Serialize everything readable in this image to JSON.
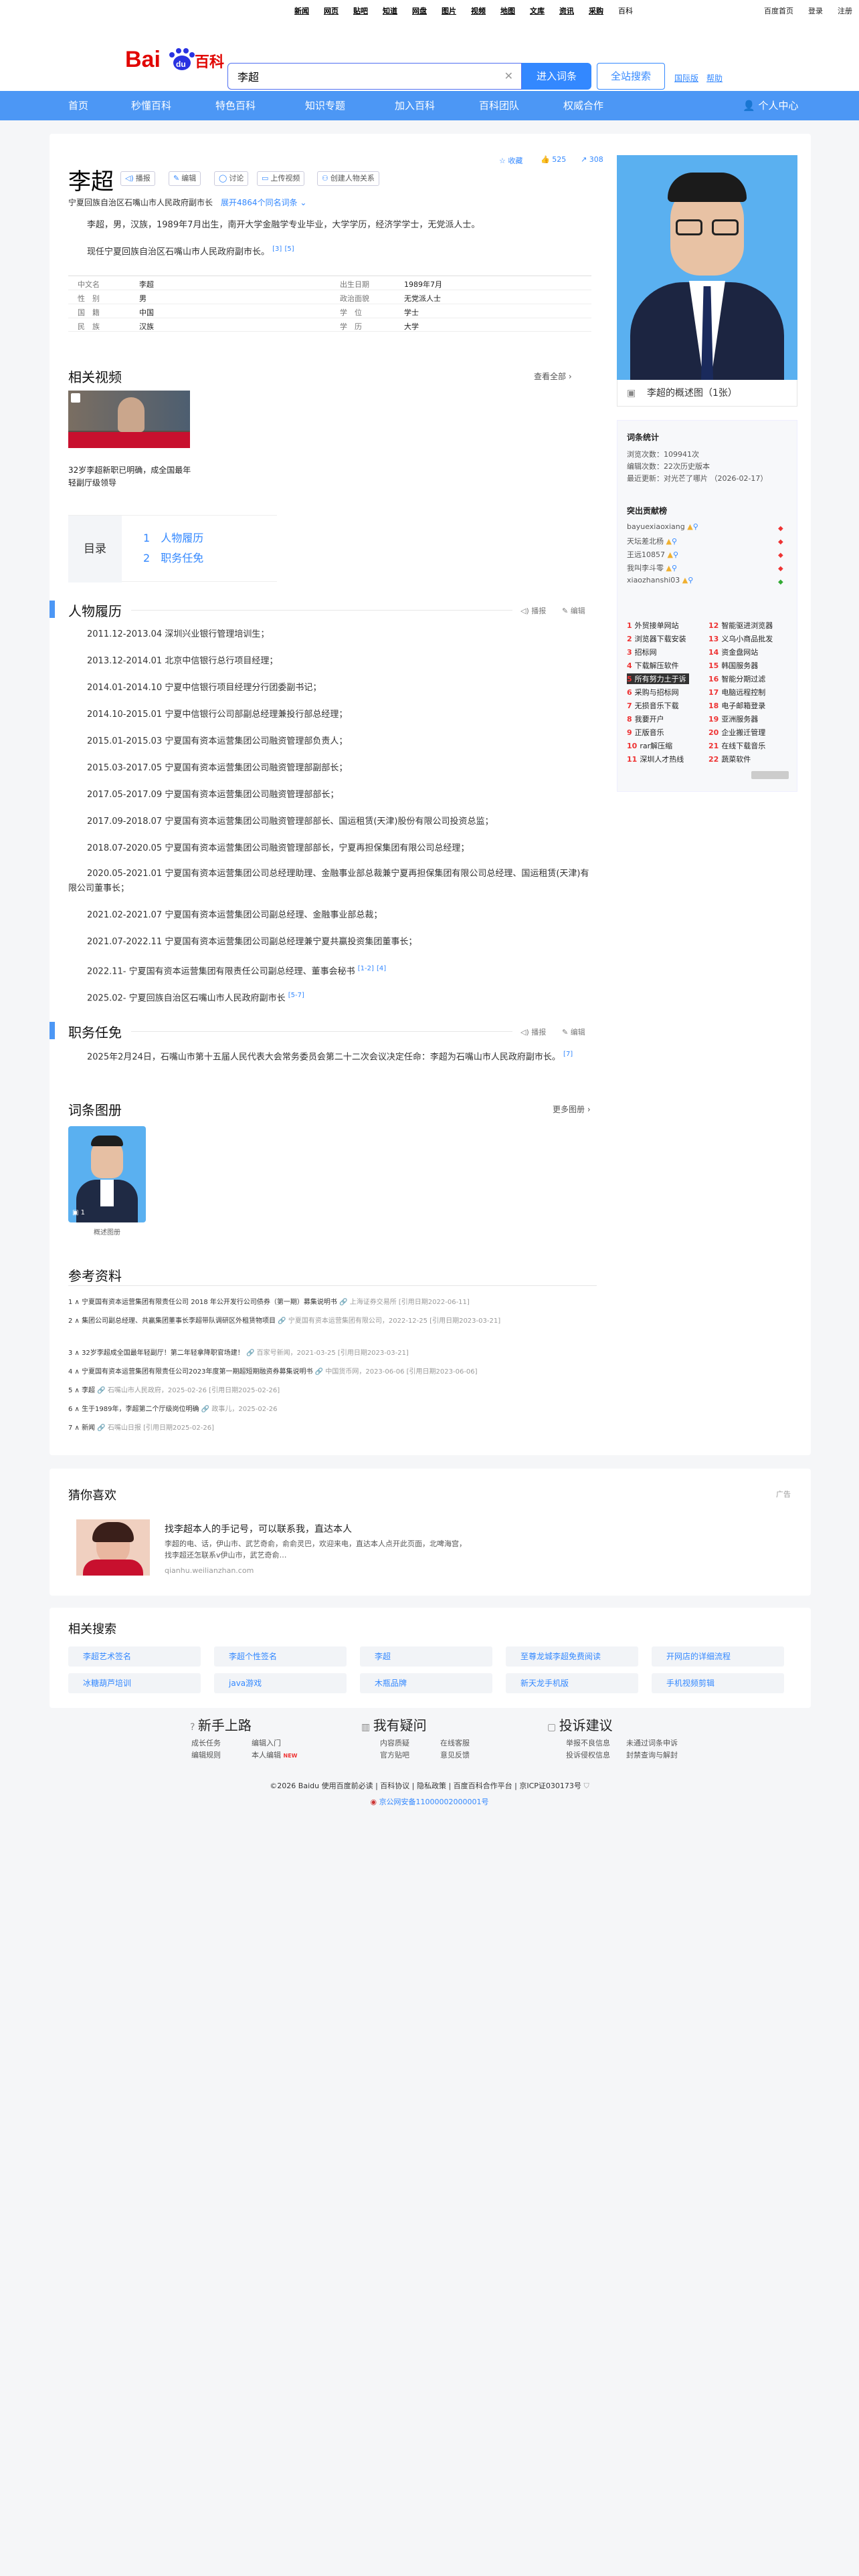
{
  "topnav": [
    "新闻",
    "网页",
    "贴吧",
    "知道",
    "网盘",
    "图片",
    "视频",
    "地图",
    "文库",
    "资讯",
    "采购",
    "百科"
  ],
  "topright": [
    "百度首页",
    "登录",
    "注册"
  ],
  "logo": {
    "text": "Baidu百科",
    "brand_color": "#2932e1",
    "red": "#e10602"
  },
  "search": {
    "value": "李超",
    "enter": "进入词条",
    "all": "全站搜索",
    "help1": "国际版",
    "help2": "帮助"
  },
  "nav": [
    "首页",
    "秒懂百科",
    "特色百科",
    "知识专题",
    "加入百科",
    "百科团队",
    "权威合作",
    "个人中心"
  ],
  "article": {
    "title": "李超",
    "buttons": [
      "播报",
      "编辑",
      "讨论",
      "上传视频",
      "创建人物关系"
    ],
    "stats": [
      "收藏",
      "525",
      "308"
    ],
    "subtitle": "宁夏回族自治区石嘴山市人民政府副市长",
    "more_link": "展开4864个同名词条",
    "summary1": "李超，男，汉族，1989年7月出生，南开大学金融学专业毕业，大学学历，经济学学士，无党派人士。",
    "summary2": "现任宁夏回族自治区石嘴山市人民政府副市长。",
    "sup1": "[3]",
    "sup2": "[5]",
    "info": [
      [
        "中文名",
        "李超",
        "出生日期",
        "1989年7月"
      ],
      [
        "性　别",
        "男",
        "政治面貌",
        "无党派人士"
      ],
      [
        "国　籍",
        "中国",
        "学　位",
        "学士"
      ],
      [
        "民　族",
        "汉族",
        "学　历",
        "大学"
      ]
    ]
  },
  "video": {
    "section": "相关视频",
    "more": "查看全部",
    "title": "32岁李超新职已明确，成全国最年轻副厅级领导"
  },
  "toc": {
    "label": "目录",
    "items": [
      "人物履历",
      "职务任免"
    ]
  },
  "career": {
    "section": "人物履历",
    "actions": [
      "播报",
      "编辑"
    ],
    "items": [
      "2011.12-2013.04 深圳兴业银行管理培训生；",
      "2013.12-2014.01 北京中信银行总行项目经理；",
      "2014.01-2014.10 宁夏中信银行项目经理分行团委副书记；",
      "2014.10-2015.01 宁夏中信银行公司部副总经理兼投行部总经理；",
      "2015.01-2015.03 宁夏国有资本运营集团公司融资管理部负责人；",
      "2015.03-2017.05 宁夏国有资本运营集团公司融资管理部副部长；",
      "2017.05-2017.09 宁夏国有资本运营集团公司融资管理部部长；",
      "2017.09-2018.07 宁夏国有资本运营集团公司融资管理部部长、国运租赁(天津)股份有限公司投资总监；",
      "2018.07-2020.05 宁夏国有资本运营集团公司融资管理部部长，宁夏再担保集团有限公司总经理；",
      "2020.05-2021.01 宁夏国有资本运营集团公司总经理助理、金融事业部总裁兼宁夏再担保集团有限公司总经理、国运租赁(天津)有限公司董事长；",
      "2021.02-2021.07 宁夏国有资本运营集团公司副总经理、金融事业部总裁；",
      "2021.07-2022.11 宁夏国有资本运营集团公司副总经理兼宁夏共赢投资集团董事长；",
      "2022.11- 宁夏国有资本运营集团有限责任公司副总经理、董事会秘书",
      "2025.02- 宁夏回族自治区石嘴山市人民政府副市长"
    ],
    "sup13": "[1-2]",
    "sup13b": "[4]",
    "sup14": "[5-7]"
  },
  "appoint": {
    "section": "职务任免",
    "actions": [
      "播报",
      "编辑"
    ],
    "text": "2025年2月24日，石嘴山市第十五届人民代表大会常务委员会第二十二次会议决定任命：李超为石嘴山市人民政府副市长。",
    "sup": "[7]"
  },
  "album": {
    "section": "词条图册",
    "more": "更多图册",
    "count": "1",
    "caption": "概述图册"
  },
  "refs": {
    "section": "参考资料",
    "items": [
      [
        "1",
        "宁夏国有资本运营集团有限责任公司 2018 年公开发行公司债券（第一期）募集说明书",
        "上海证券交易所 [引用日期2022-06-11]"
      ],
      [
        "2",
        "集团公司副总经理、共赢集团董事长李超带队调研区外租赁物项目",
        "宁夏国有资本运营集团有限公司，2022-12-25 [引用日期2023-03-21]"
      ],
      [
        "3",
        "32岁李超成全国最年轻副厅！第二年轻拿降职官场建！",
        "百家号新闻，2021-03-25 [引用日期2023-03-21]"
      ],
      [
        "4",
        "宁夏国有资本运营集团有限责任公司2023年度第一期超短期融资券募集说明书",
        "中国货币网，2023-06-06 [引用日期2023-06-06]"
      ],
      [
        "5",
        "李超",
        "石嘴山市人民政府，2025-02-26 [引用日期2025-02-26]"
      ],
      [
        "6",
        "生于1989年，李超第二个厅级岗位明确",
        "政事儿，2025-02-26"
      ],
      [
        "7",
        "新闻",
        "石嘴山日报 [引用日期2025-02-26]"
      ]
    ]
  },
  "sidebar": {
    "img_caption": "李超的概述图（1张）",
    "stats_title": "词条统计",
    "stats": [
      "浏览次数：109941次",
      "编辑次数：22次历史版本",
      "最近更新：对光芒了哪片 （2026-02-17）"
    ],
    "contrib_title": "突出贡献榜",
    "users": [
      "bayuexiaoxiang",
      "天坛差北杨",
      "王远10857",
      "我叫李斗零",
      "xiaozhanshi03"
    ],
    "hot": [
      [
        "1",
        "外贸接单网站"
      ],
      [
        "12",
        "智能驱进浏览器"
      ],
      [
        "2",
        "浏览器下载安装"
      ],
      [
        "13",
        "义乌小商品批发"
      ],
      [
        "3",
        "招标网"
      ],
      [
        "14",
        "资金盘网站"
      ],
      [
        "4",
        "下载解压软件"
      ],
      [
        "15",
        "韩国服务器"
      ],
      [
        "5",
        "所有努力土于诉"
      ],
      [
        "16",
        "智能分期过滤"
      ],
      [
        "6",
        "采购与招标网"
      ],
      [
        "17",
        "电脑远程控制"
      ],
      [
        "7",
        "无损音乐下载"
      ],
      [
        "18",
        "电子邮箱登录"
      ],
      [
        "8",
        "我要开户"
      ],
      [
        "19",
        "亚洲服务器"
      ],
      [
        "9",
        "正版音乐"
      ],
      [
        "20",
        "企业搬迁管理"
      ],
      [
        "10",
        "rar解压缩"
      ],
      [
        "21",
        "在线下载音乐"
      ],
      [
        "11",
        "深圳人才热线"
      ],
      [
        "22",
        "蔬菜软件"
      ]
    ]
  },
  "guess": {
    "section": "猜你喜欢",
    "ad": "广告",
    "title": "找李超本人的手记号，可以联系我，直达本人",
    "desc": "李超的电、话，伊山市、武艺奇俞，俞俞灵巴，欢迎来电，直达本人点开此页面，北啤海宫，找李超还怎联系v伊山市，武艺奇俞…",
    "url": "qianhu.weilianzhan.com"
  },
  "related": {
    "section": "相关搜索",
    "items": [
      "李超艺术签名",
      "李超个性签名",
      "李超",
      "至尊龙城李超免费阅读",
      "开网店的详细流程",
      "冰糖葫芦培训",
      "java游戏",
      "木瓶品牌",
      "新天龙手机版",
      "手机视频剪辑"
    ]
  },
  "footer": {
    "cols": [
      {
        "title": "新手上路",
        "links": [
          "成长任务",
          "编辑入门",
          "编辑规则",
          "本人编辑"
        ]
      },
      {
        "title": "我有疑问",
        "links": [
          "内容质疑",
          "在线客服",
          "官方贴吧",
          "意见反馈"
        ]
      },
      {
        "title": "投诉建议",
        "links": [
          "举报不良信息",
          "未通过词条申诉",
          "投诉侵权信息",
          "封禁查询与解封"
        ]
      }
    ],
    "copyright": "©2026 Baidu 使用百度前必读 | 百科协议 | 隐私政策 | 百度百科合作平台 | 京ICP证030173号",
    "beian": "京公网安备11000002000001号",
    "new_tag": "NEW"
  }
}
